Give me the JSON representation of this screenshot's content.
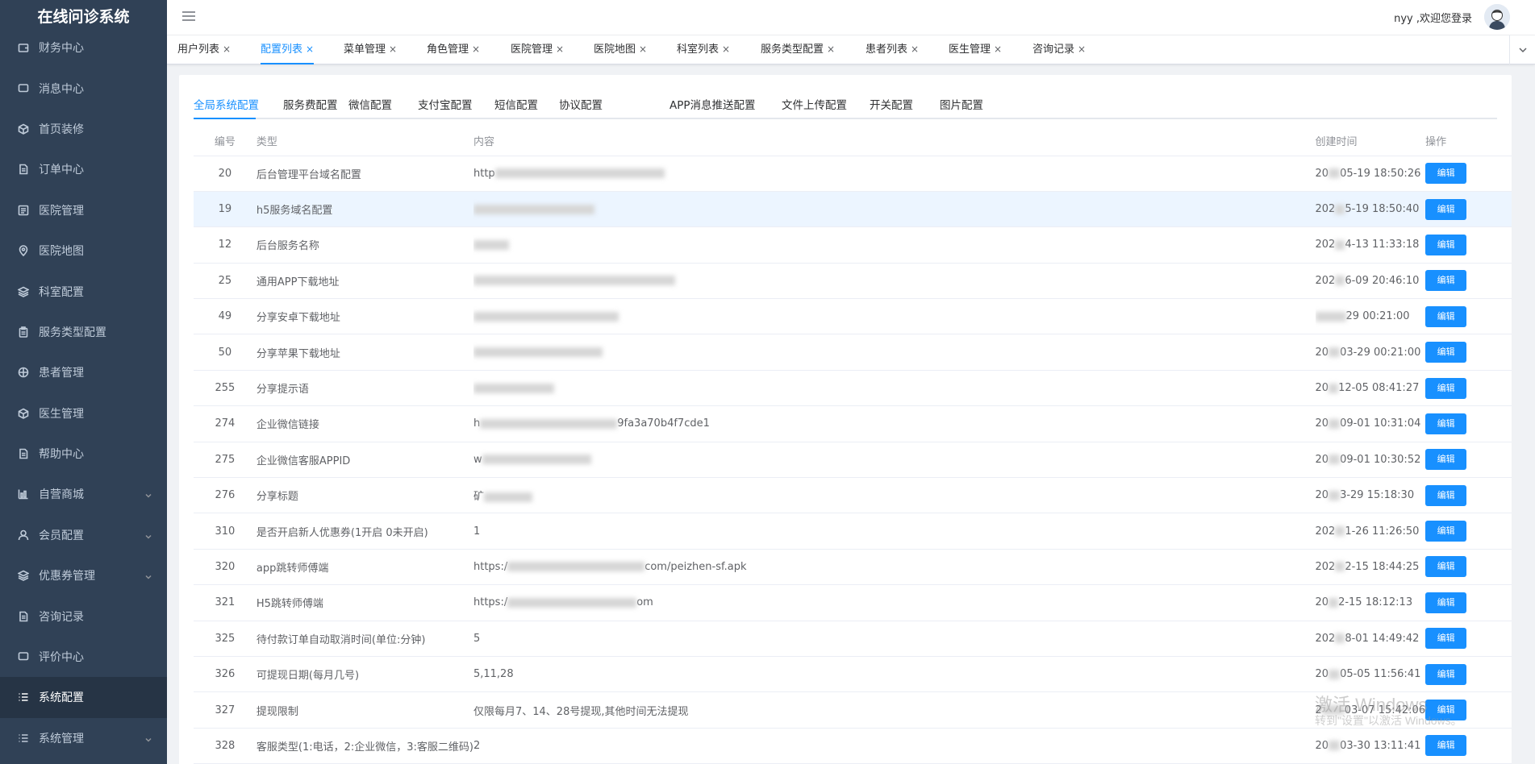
{
  "app": {
    "title": "在线问诊系统"
  },
  "sidebar": {
    "items": [
      {
        "label": "财务中心",
        "icon": "wallet-icon",
        "expandable": false
      },
      {
        "label": "消息中心",
        "icon": "message-icon",
        "expandable": false
      },
      {
        "label": "首页装修",
        "icon": "cube-icon",
        "expandable": false
      },
      {
        "label": "订单中心",
        "icon": "document-icon",
        "expandable": false
      },
      {
        "label": "医院管理",
        "icon": "list-box-icon",
        "expandable": false
      },
      {
        "label": "医院地图",
        "icon": "location-icon",
        "expandable": false
      },
      {
        "label": "科室配置",
        "icon": "layers-icon",
        "expandable": false
      },
      {
        "label": "服务类型配置",
        "icon": "clipboard-icon",
        "expandable": false
      },
      {
        "label": "患者管理",
        "icon": "grid-icon",
        "expandable": false
      },
      {
        "label": "医生管理",
        "icon": "cube-icon",
        "expandable": false
      },
      {
        "label": "帮助中心",
        "icon": "document-icon",
        "expandable": false
      },
      {
        "label": "自营商城",
        "icon": "chart-icon",
        "expandable": true
      },
      {
        "label": "会员配置",
        "icon": "user-icon",
        "expandable": true
      },
      {
        "label": "优惠券管理",
        "icon": "layers-icon",
        "expandable": true
      },
      {
        "label": "咨询记录",
        "icon": "document-icon",
        "expandable": false
      },
      {
        "label": "评价中心",
        "icon": "message-icon",
        "expandable": false
      },
      {
        "label": "系统配置",
        "icon": "list-icon",
        "expandable": false,
        "active": true
      },
      {
        "label": "系统管理",
        "icon": "list-icon",
        "expandable": true
      }
    ]
  },
  "navbar": {
    "welcome": "nyy ,欢迎您登录"
  },
  "tags": [
    {
      "label": "用户列表"
    },
    {
      "label": "配置列表",
      "active": true
    },
    {
      "label": "菜单管理"
    },
    {
      "label": "角色管理"
    },
    {
      "label": "医院管理"
    },
    {
      "label": "医院地图"
    },
    {
      "label": "科室列表"
    },
    {
      "label": "服务类型配置"
    },
    {
      "label": "患者列表"
    },
    {
      "label": "医生管理"
    },
    {
      "label": "咨询记录"
    }
  ],
  "subtabs": [
    {
      "label": "全局系统配置",
      "active": true
    },
    {
      "label": "服务费配置"
    },
    {
      "label": "微信配置"
    },
    {
      "label": "支付宝配置"
    },
    {
      "label": "短信配置"
    },
    {
      "label": "协议配置"
    },
    {
      "label": "APP消息推送配置"
    },
    {
      "label": "文件上传配置"
    },
    {
      "label": "开关配置"
    },
    {
      "label": "图片配置"
    }
  ],
  "table": {
    "headers": {
      "id": "编号",
      "type": "类型",
      "content": "内容",
      "time": "创建时间",
      "op": "操作"
    },
    "edit_label": "编辑",
    "rows": [
      {
        "id": "20",
        "type": "后台管理平台域名配置",
        "content": "http",
        "time": "20",
        "time_tail": "05-19 18:50:26"
      },
      {
        "id": "19",
        "type": "h5服务域名配置",
        "content": "",
        "time": "202",
        "time_tail": "5-19 18:50:40",
        "highlight": true
      },
      {
        "id": "12",
        "type": "后台服务名称",
        "content": "",
        "time": "202",
        "time_tail": "4-13 11:33:18"
      },
      {
        "id": "25",
        "type": "通用APP下载地址",
        "content": "",
        "time": "202",
        "time_tail": "6-09 20:46:10"
      },
      {
        "id": "49",
        "type": "分享安卓下载地址",
        "content": "",
        "time": "",
        "time_tail": "29 00:21:00"
      },
      {
        "id": "50",
        "type": "分享苹果下载地址",
        "content": "",
        "time": "20",
        "time_tail": "03-29 00:21:00"
      },
      {
        "id": "255",
        "type": "分享提示语",
        "content": "",
        "time": "20",
        "time_tail": "12-05 08:41:27"
      },
      {
        "id": "274",
        "type": "企业微信链接",
        "content": "h",
        "content_tail": "9fa3a70b4f7cde1",
        "time": "20",
        "time_tail": "09-01 10:31:04"
      },
      {
        "id": "275",
        "type": "企业微信客服APPID",
        "content": "w",
        "time": "20",
        "time_tail": "09-01 10:30:52"
      },
      {
        "id": "276",
        "type": "分享标题",
        "content": "矿",
        "time": "20",
        "time_tail": "3-29 15:18:30"
      },
      {
        "id": "310",
        "type": "是否开启新人优惠券(1开启 0未开启)",
        "content": "1",
        "time": "202",
        "time_tail": "1-26 11:26:50"
      },
      {
        "id": "320",
        "type": "app跳转师傅端",
        "content": "https:/",
        "content_tail": "com/peizhen-sf.apk",
        "time": "202",
        "time_tail": "2-15 18:44:25"
      },
      {
        "id": "321",
        "type": "H5跳转师傅端",
        "content": "https:/",
        "content_tail": "om",
        "time": "20",
        "time_tail": "2-15 18:12:13"
      },
      {
        "id": "325",
        "type": "待付款订单自动取消时间(单位:分钟)",
        "content": "5",
        "time": "202",
        "time_tail": "8-01 14:49:42"
      },
      {
        "id": "326",
        "type": "可提现日期(每月几号)",
        "content": "5,11,28",
        "time": "20",
        "time_tail": "05-05 11:56:41"
      },
      {
        "id": "327",
        "type": "提现限制",
        "content": "仅限每月7、14、28号提现,其他时间无法提现",
        "time": "2",
        "time_tail": "03-07 15:42:06"
      },
      {
        "id": "328",
        "type": "客服类型(1:电话，2:企业微信，3:客服二维码)",
        "content": "2",
        "time": "20",
        "time_tail": "03-30 13:11:41"
      }
    ]
  },
  "watermark": {
    "line1": "激活 Windows",
    "line2": "转到\"设置\"以激活 Windows。"
  },
  "colors": {
    "accent": "#1890ff",
    "sidebar_bg": "#304156",
    "sidebar_active": "#263445"
  }
}
